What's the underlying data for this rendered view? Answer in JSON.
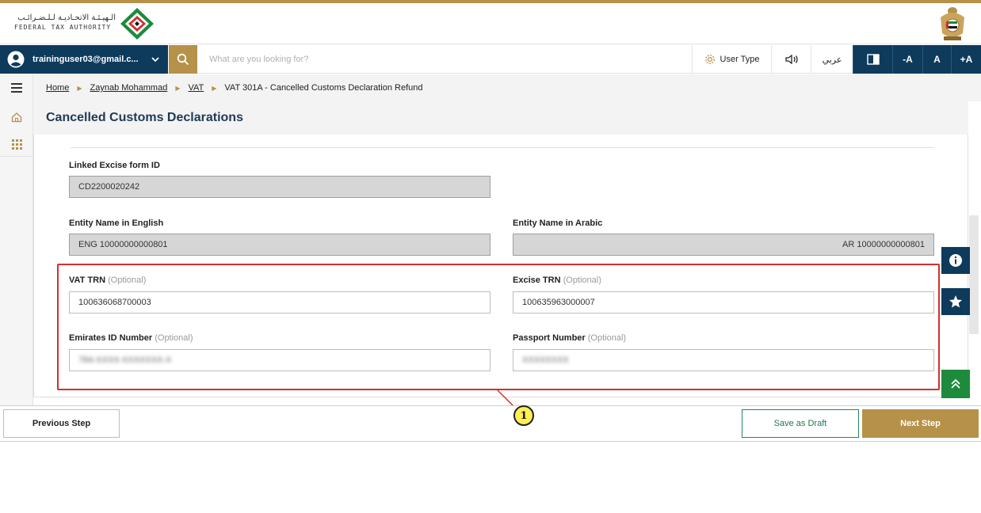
{
  "header": {
    "logo_arabic": "الـهيـئـة الاتحـاديـة لـلـضـرائـب",
    "logo_english": "FEDERAL TAX AUTHORITY"
  },
  "nav": {
    "user_email": "traininguser03@gmail.c...",
    "search_placeholder": "What are you looking for?",
    "user_type": "User Type",
    "arabic": "عربي",
    "font_smaller": "-A",
    "font_normal": "A",
    "font_larger": "+A"
  },
  "breadcrumb": {
    "items": [
      "Home",
      "Zaynab Mohammad",
      "VAT"
    ],
    "current": "VAT 301A - Cancelled Customs Declaration Refund"
  },
  "page": {
    "title": "Cancelled Customs Declarations"
  },
  "form": {
    "linked_excise_label": "Linked Excise form ID",
    "linked_excise_value": "CD2200020242",
    "entity_en_label": "Entity Name in English",
    "entity_en_value": "ENG 10000000000801",
    "entity_ar_label": "Entity Name in Arabic",
    "entity_ar_value": "AR 10000000000801",
    "vat_trn_label": "VAT TRN",
    "vat_trn_value": "100636068700003",
    "excise_trn_label": "Excise TRN",
    "excise_trn_value": "100635963000007",
    "emirates_id_label": "Emirates ID Number",
    "emirates_id_value": "784-XXXX-XXXXXXX-X",
    "passport_label": "Passport Number",
    "passport_value": "XXXXXXXX",
    "optional_text": "(Optional)"
  },
  "callout": {
    "number": "1"
  },
  "footer": {
    "previous_label": "Previous Step",
    "draft_label": "Save as Draft",
    "next_label": "Next Step"
  },
  "colors": {
    "brand_navy": "#0e3a5c",
    "brand_gold": "#b5914a",
    "highlight_red": "#d32f2f",
    "scroll_top_green": "#1d8a3c"
  }
}
